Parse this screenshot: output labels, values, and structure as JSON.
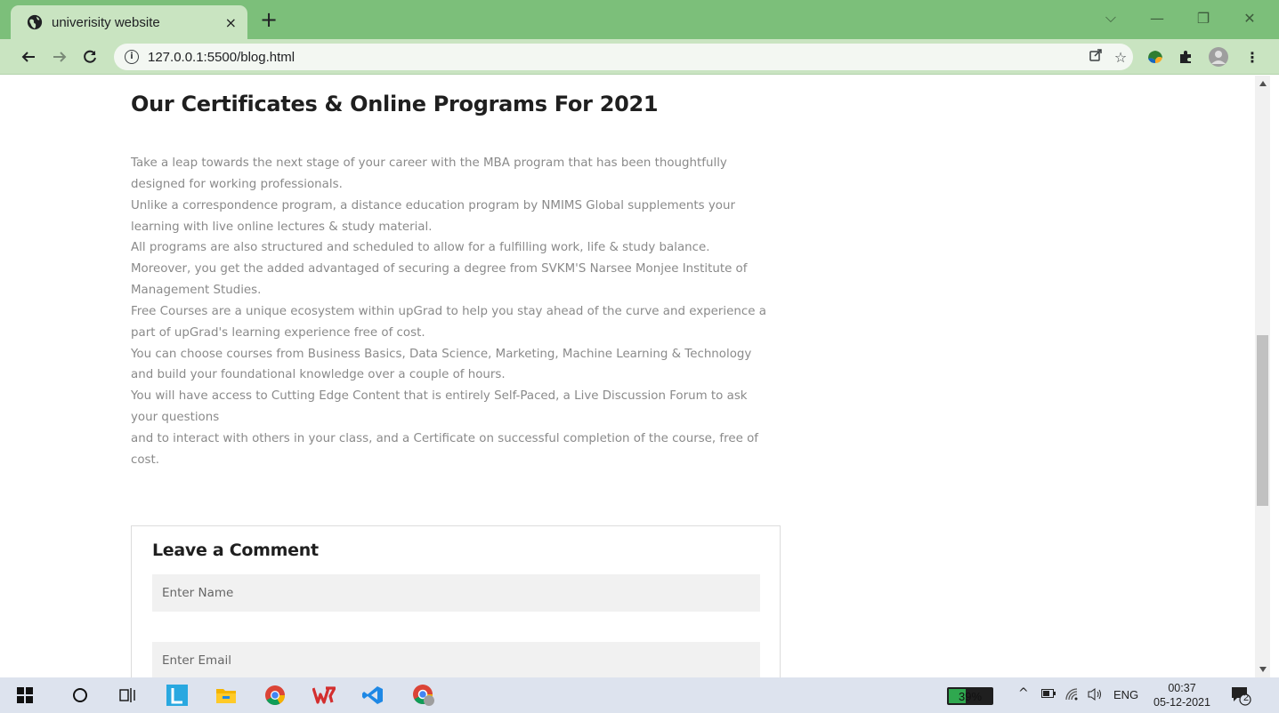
{
  "browser": {
    "tab_title": "univerisity website",
    "tab_close": "×",
    "new_tab": "+",
    "url": "127.0.0.1:5500/blog.html",
    "window_controls": [
      "⌵",
      "—",
      "❐",
      "✕"
    ]
  },
  "page": {
    "heading": "Our Certificates & Online Programs For 2021",
    "paragraph_lines": [
      "Take a leap towards the next stage of your career with the MBA program that has been thoughtfully",
      "designed for working professionals.",
      "Unlike a correspondence program, a distance education program by NMIMS Global supplements your",
      "learning with live online lectures & study material.",
      "All programs are also structured and scheduled to allow for a fulfilling work, life & study balance.",
      "Moreover, you get the added advantaged of securing a degree from SVKM'S Narsee Monjee Institute of",
      "Management Studies.",
      "Free Courses are a unique ecosystem within upGrad to help you stay ahead of the curve and experience a",
      "part of upGrad's learning experience free of cost.",
      "You can choose courses from Business Basics, Data Science, Marketing, Machine Learning & Technology",
      "and build your foundational knowledge over a couple of hours.",
      "You will have access to Cutting Edge Content that is entirely Self-Paced, a Live Discussion Forum to ask",
      "your questions",
      "and to interact with others in your class, and a Certificate on successful completion of the course, free of",
      "cost."
    ],
    "comment": {
      "title": "Leave a Comment",
      "name_placeholder": "Enter Name",
      "email_placeholder": "Enter Email"
    }
  },
  "taskbar": {
    "battery_percent": 39,
    "battery_label": "39%",
    "language": "ENG",
    "time": "00:37",
    "date": "05-12-2021",
    "notification_count": "2"
  },
  "colors": {
    "tab_strip": "#7cbf7a",
    "toolbar": "#c9e4c1",
    "heading": "#1f1f1f",
    "body_text": "#8a8a8a"
  }
}
